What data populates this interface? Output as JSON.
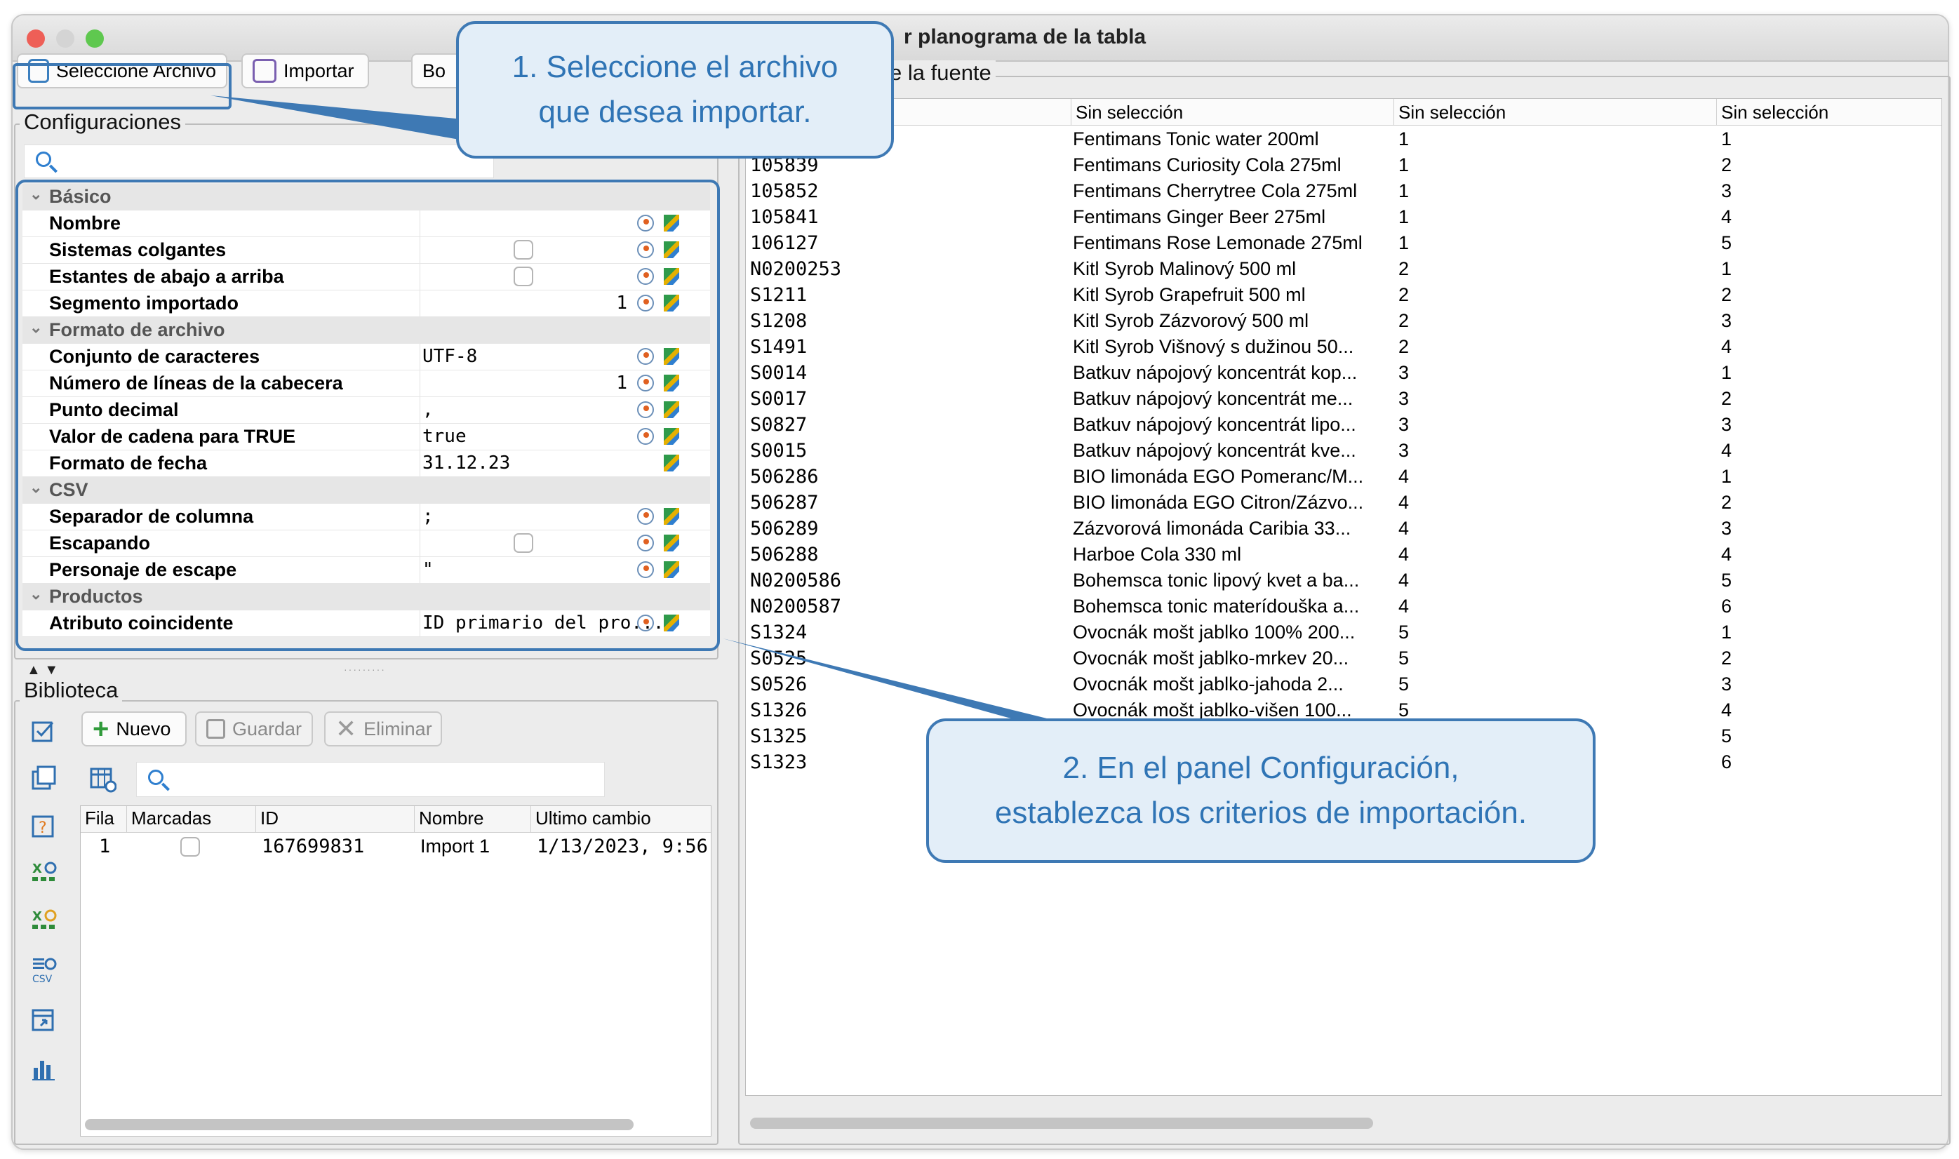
{
  "window": {
    "title": "r planograma de la tabla"
  },
  "toolbar": {
    "select_file": "Seleccione Archivo",
    "import": "Importar",
    "third_partial": "Bo"
  },
  "config": {
    "title": "Configuraciones",
    "categories": [
      {
        "label": "Básico",
        "rows": [
          {
            "name": "Nombre",
            "value": "",
            "type": "text"
          },
          {
            "name": "Sistemas colgantes",
            "value": "",
            "type": "checkbox"
          },
          {
            "name": "Estantes de abajo a arriba",
            "value": "",
            "type": "checkbox"
          },
          {
            "name": "Segmento importado",
            "value": "1",
            "type": "number"
          }
        ]
      },
      {
        "label": "Formato de archivo",
        "rows": [
          {
            "name": "Conjunto de caracteres",
            "value": "UTF-8",
            "type": "text"
          },
          {
            "name": "Número de líneas de la cabecera",
            "value": "1",
            "type": "number"
          },
          {
            "name": "Punto decimal",
            "value": ",",
            "type": "text"
          },
          {
            "name": "Valor de cadena para TRUE",
            "value": "true",
            "type": "text"
          },
          {
            "name": "Formato de fecha",
            "value": "31.12.23",
            "type": "text"
          }
        ]
      },
      {
        "label": "CSV",
        "rows": [
          {
            "name": "Separador de columna",
            "value": ";",
            "type": "text"
          },
          {
            "name": "Escapando",
            "value": "",
            "type": "checkbox"
          },
          {
            "name": "Personaje de escape",
            "value": "\"",
            "type": "text"
          }
        ]
      },
      {
        "label": "Productos",
        "rows": [
          {
            "name": "Atributo coincidente",
            "value": "ID primario del pro...",
            "type": "text"
          }
        ]
      }
    ]
  },
  "library": {
    "title": "Biblioteca",
    "new": "Nuevo",
    "save": "Guardar",
    "delete": "Eliminar",
    "columns": [
      "Fila",
      "Marcadas",
      "ID",
      "Nombre",
      "Ultimo cambio"
    ],
    "rows": [
      {
        "fila": "1",
        "id": "167699831",
        "nombre": "Import 1",
        "cambio": "1/13/2023, 9:56"
      }
    ]
  },
  "source": {
    "title": "e la fuente",
    "columns": [
      "Sin selección",
      "Sin selección",
      "Sin selección"
    ],
    "rows": [
      {
        "id": "",
        "name": "Fentimans Tonic water 200ml",
        "c3": "1",
        "c4": "1"
      },
      {
        "id": "105839",
        "name": "Fentimans Curiosity Cola 275ml",
        "c3": "1",
        "c4": "2"
      },
      {
        "id": "105852",
        "name": "Fentimans Cherrytree Cola 275ml",
        "c3": "1",
        "c4": "3"
      },
      {
        "id": "105841",
        "name": "Fentimans Ginger Beer 275ml",
        "c3": "1",
        "c4": "4"
      },
      {
        "id": "106127",
        "name": "Fentimans Rose Lemonade 275ml",
        "c3": "1",
        "c4": "5"
      },
      {
        "id": "N0200253",
        "name": "Kitl Syrob Malinový 500 ml",
        "c3": "2",
        "c4": "1"
      },
      {
        "id": "S1211",
        "name": "Kitl Syrob Grapefruit 500 ml",
        "c3": "2",
        "c4": "2"
      },
      {
        "id": "S1208",
        "name": "Kitl Syrob Zázvorový 500 ml",
        "c3": "2",
        "c4": "3"
      },
      {
        "id": "S1491",
        "name": "Kitl Syrob Višnový s dužinou 50...",
        "c3": "2",
        "c4": "4"
      },
      {
        "id": "S0014",
        "name": "Batkuv nápojový koncentrát kop...",
        "c3": "3",
        "c4": "1"
      },
      {
        "id": "S0017",
        "name": "Batkuv nápojový koncentrát me...",
        "c3": "3",
        "c4": "2"
      },
      {
        "id": "S0827",
        "name": "Batkuv nápojový koncentrát lipo...",
        "c3": "3",
        "c4": "3"
      },
      {
        "id": "S0015",
        "name": "Batkuv nápojový koncentrát kve...",
        "c3": "3",
        "c4": "4"
      },
      {
        "id": "506286",
        "name": "BIO limonáda EGO Pomeranc/M...",
        "c3": "4",
        "c4": "1"
      },
      {
        "id": "506287",
        "name": "BIO limonáda EGO Citron/Zázvo...",
        "c3": "4",
        "c4": "2"
      },
      {
        "id": "506289",
        "name": "Zázvorová limonáda Caribia 33...",
        "c3": "4",
        "c4": "3"
      },
      {
        "id": "506288",
        "name": "Harboe Cola 330 ml",
        "c3": "4",
        "c4": "4"
      },
      {
        "id": "N0200586",
        "name": "Bohemsca tonic lipový kvet a ba...",
        "c3": "4",
        "c4": "5"
      },
      {
        "id": "N0200587",
        "name": "Bohemsca tonic materídouška a...",
        "c3": "4",
        "c4": "6"
      },
      {
        "id": "S1324",
        "name": "Ovocnák mošt jablko 100% 200...",
        "c3": "5",
        "c4": "1"
      },
      {
        "id": "S0525",
        "name": "Ovocnák mošt jablko-mrkev 20...",
        "c3": "5",
        "c4": "2"
      },
      {
        "id": "S0526",
        "name": "Ovocnák mošt jablko-jahoda 2...",
        "c3": "5",
        "c4": "3"
      },
      {
        "id": "S1326",
        "name": "Ovocnák mošt jablko-višen 100...",
        "c3": "5",
        "c4": "4"
      },
      {
        "id": "S1325",
        "name": "",
        "c3": "",
        "c4": "5"
      },
      {
        "id": "S1323",
        "name": "",
        "c3": "",
        "c4": "6"
      }
    ]
  },
  "callouts": {
    "first_line1": "1. Seleccione el archivo",
    "first_line2": "que desea importar.",
    "second_line1": "2. En el panel Configuración,",
    "second_line2": "establezca los criterios de importación."
  },
  "colors": {
    "callout_border": "#3e79b4",
    "callout_fill": "#e3eef8",
    "callout_text": "#2f74b5"
  }
}
